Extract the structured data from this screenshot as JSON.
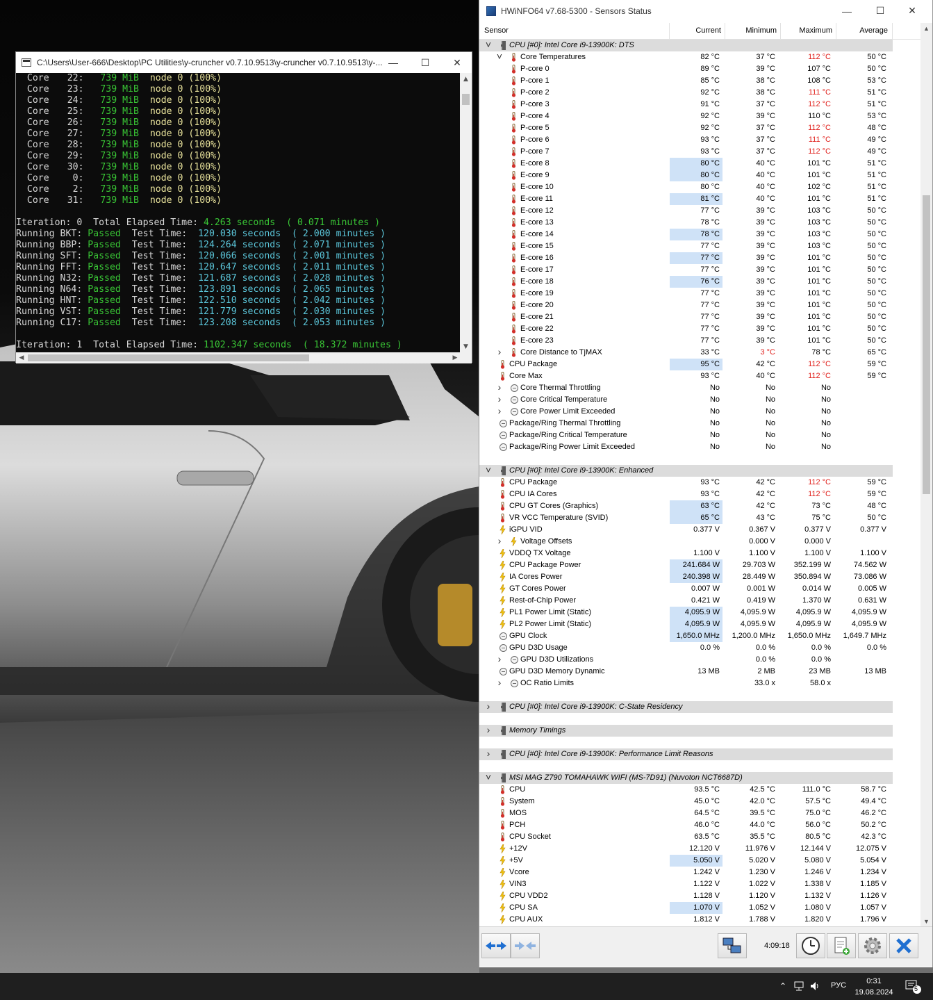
{
  "console": {
    "title": "C:\\Users\\User-666\\Desktop\\PC Utilities\\y-cruncher v0.7.10.9513\\y-cruncher v0.7.10.9513\\y-...",
    "core_lines": [
      {
        "core": "22",
        "mem": "739 MiB",
        "node": "node 0 (100%)"
      },
      {
        "core": "23",
        "mem": "739 MiB",
        "node": "node 0 (100%)"
      },
      {
        "core": "24",
        "mem": "739 MiB",
        "node": "node 0 (100%)"
      },
      {
        "core": "25",
        "mem": "739 MiB",
        "node": "node 0 (100%)"
      },
      {
        "core": "26",
        "mem": "739 MiB",
        "node": "node 0 (100%)"
      },
      {
        "core": "27",
        "mem": "739 MiB",
        "node": "node 0 (100%)"
      },
      {
        "core": "28",
        "mem": "739 MiB",
        "node": "node 0 (100%)"
      },
      {
        "core": "29",
        "mem": "739 MiB",
        "node": "node 0 (100%)"
      },
      {
        "core": "30",
        "mem": "739 MiB",
        "node": "node 0 (100%)"
      },
      {
        "core": "0",
        "mem": "739 MiB",
        "node": "node 0 (100%)"
      },
      {
        "core": "2",
        "mem": "739 MiB",
        "node": "node 0 (100%)"
      },
      {
        "core": "31",
        "mem": "739 MiB",
        "node": "node 0 (100%)"
      }
    ],
    "iteration0": {
      "label": "Iteration: 0  Total Elapsed Time:",
      "seconds": "4.263 seconds",
      "minutes": "( 0.071 minutes )"
    },
    "tests": [
      {
        "name": "Running BKT:",
        "status": "Passed",
        "label": "Test Time:",
        "seconds": "120.030 seconds",
        "minutes": "( 2.000 minutes )"
      },
      {
        "name": "Running BBP:",
        "status": "Passed",
        "label": "Test Time:",
        "seconds": "124.264 seconds",
        "minutes": "( 2.071 minutes )"
      },
      {
        "name": "Running SFT:",
        "status": "Passed",
        "label": "Test Time:",
        "seconds": "120.066 seconds",
        "minutes": "( 2.001 minutes )"
      },
      {
        "name": "Running FFT:",
        "status": "Passed",
        "label": "Test Time:",
        "seconds": "120.647 seconds",
        "minutes": "( 2.011 minutes )"
      },
      {
        "name": "Running N32:",
        "status": "Passed",
        "label": "Test Time:",
        "seconds": "121.687 seconds",
        "minutes": "( 2.028 minutes )"
      },
      {
        "name": "Running N64:",
        "status": "Passed",
        "label": "Test Time:",
        "seconds": "123.891 seconds",
        "minutes": "( 2.065 minutes )"
      },
      {
        "name": "Running HNT:",
        "status": "Passed",
        "label": "Test Time:",
        "seconds": "122.510 seconds",
        "minutes": "( 2.042 minutes )"
      },
      {
        "name": "Running VST:",
        "status": "Passed",
        "label": "Test Time:",
        "seconds": "121.779 seconds",
        "minutes": "( 2.030 minutes )"
      },
      {
        "name": "Running C17:",
        "status": "Passed",
        "label": "Test Time:",
        "seconds": "123.208 seconds",
        "minutes": "( 2.053 minutes )"
      }
    ],
    "iteration1": {
      "label": "Iteration: 1  Total Elapsed Time:",
      "seconds": "1102.347 seconds",
      "minutes": "( 18.372 minutes )"
    }
  },
  "hwinfo": {
    "title": "HWiNFO64 v7.68-5300 - Sensors Status",
    "columns": {
      "sensor": "Sensor",
      "current": "Current",
      "minimum": "Minimum",
      "maximum": "Maximum",
      "average": "Average"
    },
    "rows": [
      {
        "t": "group",
        "exp": "v",
        "label": "CPU [#0]: Intel Core i9-13900K: DTS"
      },
      {
        "t": "item",
        "lvl": 1,
        "exp": "v",
        "icon": "therm",
        "label": "Core Temperatures",
        "cur": "82 °C",
        "min": "37 °C",
        "max": "112 °C",
        "avg": "50 °C",
        "maxred": true
      },
      {
        "t": "item",
        "lvl": 2,
        "icon": "therm",
        "label": "P-core 0",
        "cur": "89 °C",
        "min": "39 °C",
        "max": "107 °C",
        "avg": "50 °C"
      },
      {
        "t": "item",
        "lvl": 2,
        "icon": "therm",
        "label": "P-core 1",
        "cur": "85 °C",
        "min": "38 °C",
        "max": "108 °C",
        "avg": "53 °C"
      },
      {
        "t": "item",
        "lvl": 2,
        "icon": "therm",
        "label": "P-core 2",
        "cur": "92 °C",
        "min": "38 °C",
        "max": "111 °C",
        "avg": "51 °C",
        "maxred": true
      },
      {
        "t": "item",
        "lvl": 2,
        "icon": "therm",
        "label": "P-core 3",
        "cur": "91 °C",
        "min": "37 °C",
        "max": "112 °C",
        "avg": "51 °C",
        "maxred": true
      },
      {
        "t": "item",
        "lvl": 2,
        "icon": "therm",
        "label": "P-core 4",
        "cur": "92 °C",
        "min": "39 °C",
        "max": "110 °C",
        "avg": "53 °C"
      },
      {
        "t": "item",
        "lvl": 2,
        "icon": "therm",
        "label": "P-core 5",
        "cur": "92 °C",
        "min": "37 °C",
        "max": "112 °C",
        "avg": "48 °C",
        "maxred": true
      },
      {
        "t": "item",
        "lvl": 2,
        "icon": "therm",
        "label": "P-core 6",
        "cur": "93 °C",
        "min": "37 °C",
        "max": "111 °C",
        "avg": "49 °C",
        "maxred": true
      },
      {
        "t": "item",
        "lvl": 2,
        "icon": "therm",
        "label": "P-core 7",
        "cur": "93 °C",
        "min": "37 °C",
        "max": "112 °C",
        "avg": "49 °C",
        "maxred": true
      },
      {
        "t": "item",
        "lvl": 2,
        "icon": "therm",
        "label": "E-core 8",
        "cur": "80 °C",
        "min": "40 °C",
        "max": "101 °C",
        "avg": "51 °C",
        "hl": true
      },
      {
        "t": "item",
        "lvl": 2,
        "icon": "therm",
        "label": "E-core 9",
        "cur": "80 °C",
        "min": "40 °C",
        "max": "101 °C",
        "avg": "51 °C",
        "hl": true
      },
      {
        "t": "item",
        "lvl": 2,
        "icon": "therm",
        "label": "E-core 10",
        "cur": "80 °C",
        "min": "40 °C",
        "max": "102 °C",
        "avg": "51 °C"
      },
      {
        "t": "item",
        "lvl": 2,
        "icon": "therm",
        "label": "E-core 11",
        "cur": "81 °C",
        "min": "40 °C",
        "max": "101 °C",
        "avg": "51 °C",
        "hl": true
      },
      {
        "t": "item",
        "lvl": 2,
        "icon": "therm",
        "label": "E-core 12",
        "cur": "77 °C",
        "min": "39 °C",
        "max": "103 °C",
        "avg": "50 °C"
      },
      {
        "t": "item",
        "lvl": 2,
        "icon": "therm",
        "label": "E-core 13",
        "cur": "78 °C",
        "min": "39 °C",
        "max": "103 °C",
        "avg": "50 °C"
      },
      {
        "t": "item",
        "lvl": 2,
        "icon": "therm",
        "label": "E-core 14",
        "cur": "78 °C",
        "min": "39 °C",
        "max": "103 °C",
        "avg": "50 °C",
        "hl": true
      },
      {
        "t": "item",
        "lvl": 2,
        "icon": "therm",
        "label": "E-core 15",
        "cur": "77 °C",
        "min": "39 °C",
        "max": "103 °C",
        "avg": "50 °C"
      },
      {
        "t": "item",
        "lvl": 2,
        "icon": "therm",
        "label": "E-core 16",
        "cur": "77 °C",
        "min": "39 °C",
        "max": "101 °C",
        "avg": "50 °C",
        "hl": true
      },
      {
        "t": "item",
        "lvl": 2,
        "icon": "therm",
        "label": "E-core 17",
        "cur": "77 °C",
        "min": "39 °C",
        "max": "101 °C",
        "avg": "50 °C"
      },
      {
        "t": "item",
        "lvl": 2,
        "icon": "therm",
        "label": "E-core 18",
        "cur": "76 °C",
        "min": "39 °C",
        "max": "101 °C",
        "avg": "50 °C",
        "hl": true
      },
      {
        "t": "item",
        "lvl": 2,
        "icon": "therm",
        "label": "E-core 19",
        "cur": "77 °C",
        "min": "39 °C",
        "max": "101 °C",
        "avg": "50 °C"
      },
      {
        "t": "item",
        "lvl": 2,
        "icon": "therm",
        "label": "E-core 20",
        "cur": "77 °C",
        "min": "39 °C",
        "max": "101 °C",
        "avg": "50 °C"
      },
      {
        "t": "item",
        "lvl": 2,
        "icon": "therm",
        "label": "E-core 21",
        "cur": "77 °C",
        "min": "39 °C",
        "max": "101 °C",
        "avg": "50 °C"
      },
      {
        "t": "item",
        "lvl": 2,
        "icon": "therm",
        "label": "E-core 22",
        "cur": "77 °C",
        "min": "39 °C",
        "max": "101 °C",
        "avg": "50 °C"
      },
      {
        "t": "item",
        "lvl": 2,
        "icon": "therm",
        "label": "E-core 23",
        "cur": "77 °C",
        "min": "39 °C",
        "max": "101 °C",
        "avg": "50 °C"
      },
      {
        "t": "item",
        "lvl": 1,
        "exp": ">",
        "icon": "therm",
        "label": "Core Distance to TjMAX",
        "cur": "33 °C",
        "min": "3 °C",
        "max": "78 °C",
        "avg": "65 °C",
        "minred": true
      },
      {
        "t": "item",
        "lvl": 0,
        "icon": "therm",
        "label": "CPU Package",
        "cur": "95 °C",
        "min": "42 °C",
        "max": "112 °C",
        "avg": "59 °C",
        "hl": true,
        "maxred": true
      },
      {
        "t": "item",
        "lvl": 0,
        "icon": "therm",
        "label": "Core Max",
        "cur": "93 °C",
        "min": "40 °C",
        "max": "112 °C",
        "avg": "59 °C",
        "maxred": true
      },
      {
        "t": "item",
        "lvl": 1,
        "exp": ">",
        "icon": "circ",
        "label": "Core Thermal Throttling",
        "cur": "No",
        "min": "No",
        "max": "No",
        "avg": ""
      },
      {
        "t": "item",
        "lvl": 1,
        "exp": ">",
        "icon": "circ",
        "label": "Core Critical Temperature",
        "cur": "No",
        "min": "No",
        "max": "No",
        "avg": ""
      },
      {
        "t": "item",
        "lvl": 1,
        "exp": ">",
        "icon": "circ",
        "label": "Core Power Limit Exceeded",
        "cur": "No",
        "min": "No",
        "max": "No",
        "avg": ""
      },
      {
        "t": "item",
        "lvl": 0,
        "icon": "circ",
        "label": "Package/Ring Thermal Throttling",
        "cur": "No",
        "min": "No",
        "max": "No",
        "avg": ""
      },
      {
        "t": "item",
        "lvl": 0,
        "icon": "circ",
        "label": "Package/Ring Critical Temperature",
        "cur": "No",
        "min": "No",
        "max": "No",
        "avg": ""
      },
      {
        "t": "item",
        "lvl": 0,
        "icon": "circ",
        "label": "Package/Ring Power Limit Exceeded",
        "cur": "No",
        "min": "No",
        "max": "No",
        "avg": ""
      },
      {
        "t": "blank"
      },
      {
        "t": "group",
        "exp": "v",
        "label": "CPU [#0]: Intel Core i9-13900K: Enhanced"
      },
      {
        "t": "item",
        "lvl": 0,
        "icon": "therm",
        "label": "CPU Package",
        "cur": "93 °C",
        "min": "42 °C",
        "max": "112 °C",
        "avg": "59 °C",
        "maxred": true
      },
      {
        "t": "item",
        "lvl": 0,
        "icon": "therm",
        "label": "CPU IA Cores",
        "cur": "93 °C",
        "min": "42 °C",
        "max": "112 °C",
        "avg": "59 °C",
        "maxred": true
      },
      {
        "t": "item",
        "lvl": 0,
        "icon": "therm",
        "label": "CPU GT Cores (Graphics)",
        "cur": "63 °C",
        "min": "42 °C",
        "max": "73 °C",
        "avg": "48 °C",
        "hl": true
      },
      {
        "t": "item",
        "lvl": 0,
        "icon": "therm",
        "label": "VR VCC Temperature (SVID)",
        "cur": "65 °C",
        "min": "43 °C",
        "max": "75 °C",
        "avg": "50 °C",
        "hl": true
      },
      {
        "t": "item",
        "lvl": 0,
        "icon": "bolt",
        "label": "iGPU VID",
        "cur": "0.377 V",
        "min": "0.367 V",
        "max": "0.377 V",
        "avg": "0.377 V"
      },
      {
        "t": "item",
        "lvl": 1,
        "exp": ">",
        "icon": "bolt",
        "label": "Voltage Offsets",
        "cur": "",
        "min": "0.000 V",
        "max": "0.000 V",
        "avg": ""
      },
      {
        "t": "item",
        "lvl": 0,
        "icon": "bolt",
        "label": "VDDQ TX Voltage",
        "cur": "1.100 V",
        "min": "1.100 V",
        "max": "1.100 V",
        "avg": "1.100 V"
      },
      {
        "t": "item",
        "lvl": 0,
        "icon": "bolt",
        "label": "CPU Package Power",
        "cur": "241.684 W",
        "min": "29.703 W",
        "max": "352.199 W",
        "avg": "74.562 W",
        "hl": true
      },
      {
        "t": "item",
        "lvl": 0,
        "icon": "bolt",
        "label": "IA Cores Power",
        "cur": "240.398 W",
        "min": "28.449 W",
        "max": "350.894 W",
        "avg": "73.086 W",
        "hl": true
      },
      {
        "t": "item",
        "lvl": 0,
        "icon": "bolt",
        "label": "GT Cores Power",
        "cur": "0.007 W",
        "min": "0.001 W",
        "max": "0.014 W",
        "avg": "0.005 W"
      },
      {
        "t": "item",
        "lvl": 0,
        "icon": "bolt",
        "label": "Rest-of-Chip Power",
        "cur": "0.421 W",
        "min": "0.419 W",
        "max": "1.370 W",
        "avg": "0.631 W"
      },
      {
        "t": "item",
        "lvl": 0,
        "icon": "bolt",
        "label": "PL1 Power Limit (Static)",
        "cur": "4,095.9 W",
        "min": "4,095.9 W",
        "max": "4,095.9 W",
        "avg": "4,095.9 W",
        "hl": true
      },
      {
        "t": "item",
        "lvl": 0,
        "icon": "bolt",
        "label": "PL2 Power Limit (Static)",
        "cur": "4,095.9 W",
        "min": "4,095.9 W",
        "max": "4,095.9 W",
        "avg": "4,095.9 W",
        "hl": true
      },
      {
        "t": "item",
        "lvl": 0,
        "icon": "circ",
        "label": "GPU Clock",
        "cur": "1,650.0 MHz",
        "min": "1,200.0 MHz",
        "max": "1,650.0 MHz",
        "avg": "1,649.7 MHz",
        "hl": true
      },
      {
        "t": "item",
        "lvl": 0,
        "icon": "circ",
        "label": "GPU D3D Usage",
        "cur": "0.0 %",
        "min": "0.0 %",
        "max": "0.0 %",
        "avg": "0.0 %"
      },
      {
        "t": "item",
        "lvl": 1,
        "exp": ">",
        "icon": "circ",
        "label": "GPU D3D Utilizations",
        "cur": "",
        "min": "0.0 %",
        "max": "0.0 %",
        "avg": ""
      },
      {
        "t": "item",
        "lvl": 0,
        "icon": "circ",
        "label": "GPU D3D Memory Dynamic",
        "cur": "13 MB",
        "min": "2 MB",
        "max": "23 MB",
        "avg": "13 MB"
      },
      {
        "t": "item",
        "lvl": 1,
        "exp": ">",
        "icon": "circ",
        "label": "OC Ratio Limits",
        "cur": "",
        "min": "33.0 x",
        "max": "58.0 x",
        "avg": ""
      },
      {
        "t": "blank"
      },
      {
        "t": "group",
        "exp": ">",
        "label": "CPU [#0]: Intel Core i9-13900K: C-State Residency"
      },
      {
        "t": "blank"
      },
      {
        "t": "group",
        "exp": ">",
        "label": "Memory Timings"
      },
      {
        "t": "blank"
      },
      {
        "t": "group",
        "exp": ">",
        "label": "CPU [#0]: Intel Core i9-13900K: Performance Limit Reasons"
      },
      {
        "t": "blank"
      },
      {
        "t": "group",
        "exp": "v",
        "label": "MSI MAG Z790 TOMAHAWK WIFI (MS-7D91) (Nuvoton NCT6687D)"
      },
      {
        "t": "item",
        "lvl": 0,
        "icon": "therm",
        "label": "CPU",
        "cur": "93.5 °C",
        "min": "42.5 °C",
        "max": "111.0 °C",
        "avg": "58.7 °C"
      },
      {
        "t": "item",
        "lvl": 0,
        "icon": "therm",
        "label": "System",
        "cur": "45.0 °C",
        "min": "42.0 °C",
        "max": "57.5 °C",
        "avg": "49.4 °C"
      },
      {
        "t": "item",
        "lvl": 0,
        "icon": "therm",
        "label": "MOS",
        "cur": "64.5 °C",
        "min": "39.5 °C",
        "max": "75.0 °C",
        "avg": "46.2 °C"
      },
      {
        "t": "item",
        "lvl": 0,
        "icon": "therm",
        "label": "PCH",
        "cur": "46.0 °C",
        "min": "44.0 °C",
        "max": "56.0 °C",
        "avg": "50.2 °C"
      },
      {
        "t": "item",
        "lvl": 0,
        "icon": "therm",
        "label": "CPU Socket",
        "cur": "63.5 °C",
        "min": "35.5 °C",
        "max": "80.5 °C",
        "avg": "42.3 °C"
      },
      {
        "t": "item",
        "lvl": 0,
        "icon": "bolt",
        "label": "+12V",
        "cur": "12.120 V",
        "min": "11.976 V",
        "max": "12.144 V",
        "avg": "12.075 V"
      },
      {
        "t": "item",
        "lvl": 0,
        "icon": "bolt",
        "label": "+5V",
        "cur": "5.050 V",
        "min": "5.020 V",
        "max": "5.080 V",
        "avg": "5.054 V",
        "hl": true
      },
      {
        "t": "item",
        "lvl": 0,
        "icon": "bolt",
        "label": "Vcore",
        "cur": "1.242 V",
        "min": "1.230 V",
        "max": "1.246 V",
        "avg": "1.234 V"
      },
      {
        "t": "item",
        "lvl": 0,
        "icon": "bolt",
        "label": "VIN3",
        "cur": "1.122 V",
        "min": "1.022 V",
        "max": "1.338 V",
        "avg": "1.185 V"
      },
      {
        "t": "item",
        "lvl": 0,
        "icon": "bolt",
        "label": "CPU VDD2",
        "cur": "1.128 V",
        "min": "1.120 V",
        "max": "1.132 V",
        "avg": "1.126 V"
      },
      {
        "t": "item",
        "lvl": 0,
        "icon": "bolt",
        "label": "CPU SA",
        "cur": "1.070 V",
        "min": "1.052 V",
        "max": "1.080 V",
        "avg": "1.057 V",
        "hl": true
      },
      {
        "t": "item",
        "lvl": 0,
        "icon": "bolt",
        "label": "CPU AUX",
        "cur": "1.812 V",
        "min": "1.788 V",
        "max": "1.820 V",
        "avg": "1.796 V"
      }
    ],
    "timer": "4:09:18"
  },
  "taskbar": {
    "language": "РУС",
    "time": "0:31",
    "date": "19.08.2024",
    "notifications": "5"
  },
  "colors": {
    "console_green": "#39c535",
    "console_yellow": "#e8e29b",
    "console_cyan": "#5bc6da",
    "max_red": "#e0201c",
    "highlight": "#cfe2f7"
  }
}
